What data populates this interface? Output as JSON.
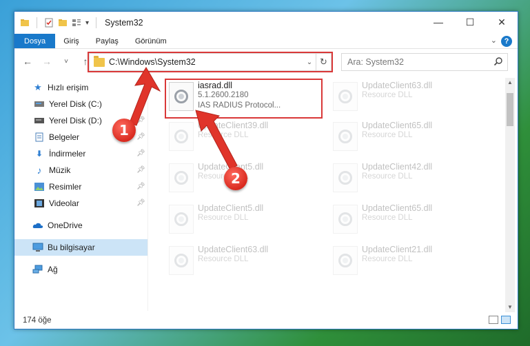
{
  "window": {
    "title": "System32",
    "controls": {
      "minimize": "—",
      "maximize": "☐",
      "close": "✕"
    }
  },
  "ribbon": {
    "tabs": [
      {
        "label": "Dosya",
        "active": true
      },
      {
        "label": "Giriş"
      },
      {
        "label": "Paylaş"
      },
      {
        "label": "Görünüm"
      }
    ],
    "help": "?"
  },
  "navigation": {
    "back": "←",
    "forward": "→",
    "recent": "˅",
    "up": "↑"
  },
  "address_bar": {
    "path": "C:\\Windows\\System32",
    "refresh_icon": "refresh-icon"
  },
  "search": {
    "placeholder": "Ara: System32"
  },
  "sidebar": {
    "items": [
      {
        "label": "Hızlı erişim",
        "icon": "star-icon"
      },
      {
        "label": "Yerel Disk (C:)",
        "icon": "drive-icon",
        "pinned": true
      },
      {
        "label": "Yerel Disk (D:)",
        "icon": "drive-icon",
        "pinned": true
      },
      {
        "label": "Belgeler",
        "icon": "documents-icon",
        "pinned": true
      },
      {
        "label": "İndirmeler",
        "icon": "download-icon",
        "pinned": true
      },
      {
        "label": "Müzik",
        "icon": "music-icon",
        "pinned": true
      },
      {
        "label": "Resimler",
        "icon": "pictures-icon",
        "pinned": true
      },
      {
        "label": "Videolar",
        "icon": "videos-icon",
        "pinned": true
      },
      {
        "label": "OneDrive",
        "icon": "cloud-icon"
      },
      {
        "label": "Bu bilgisayar",
        "icon": "computer-icon",
        "selected": true
      },
      {
        "label": "Ağ",
        "icon": "network-icon"
      }
    ]
  },
  "files": [
    {
      "name": "iasrad.dll",
      "version": "5.1.2600.2180",
      "desc": "IAS RADIUS Protocol..."
    },
    {
      "name": "UpdateClient63.dll",
      "desc": "Resource DLL"
    },
    {
      "name": "UpdateClient39.dll",
      "desc": "Resource DLL"
    },
    {
      "name": "UpdateClient65.dll",
      "desc": "Resource DLL"
    },
    {
      "name": "UpdateClient5.dll",
      "desc": "Resource DLL"
    },
    {
      "name": "UpdateClient42.dll",
      "desc": "Resource DLL"
    },
    {
      "name": "UpdateClient5.dll",
      "desc": "Resource DLL"
    },
    {
      "name": "UpdateClient65.dll",
      "desc": "Resource DLL"
    },
    {
      "name": "UpdateClient63.dll",
      "desc": "Resource DLL"
    },
    {
      "name": "UpdateClient21.dll",
      "desc": "Resource DLL"
    }
  ],
  "status": {
    "count": "174 öğe"
  },
  "callouts": [
    "1",
    "2"
  ],
  "colors": {
    "accent": "#1979ca",
    "highlight": "#d93838",
    "selection": "#cce4f7"
  }
}
